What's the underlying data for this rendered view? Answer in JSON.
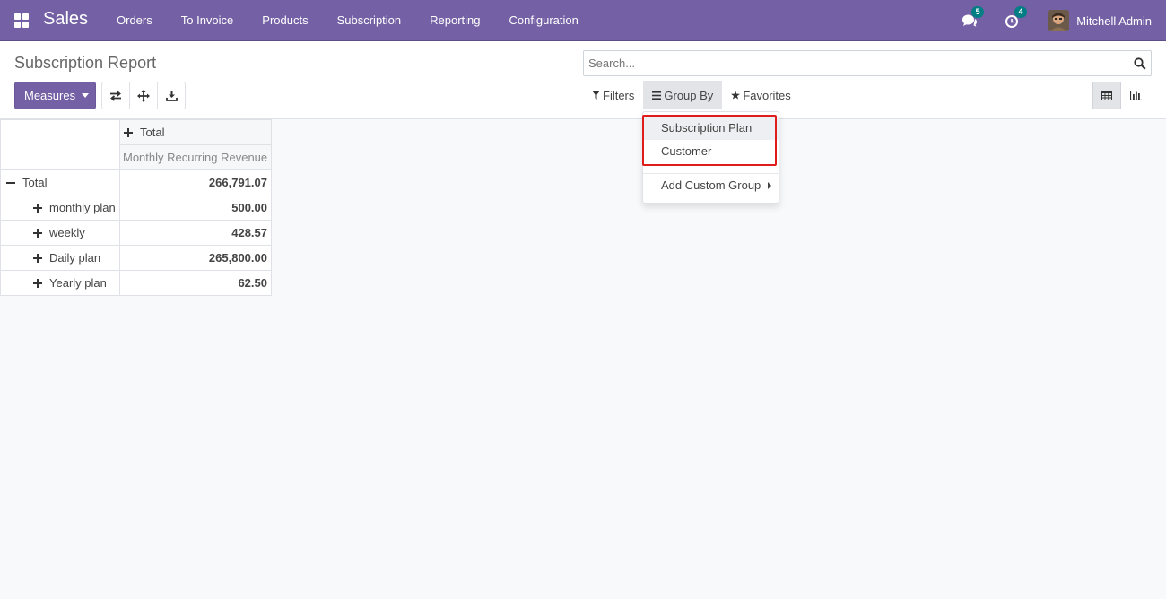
{
  "navbar": {
    "brand": "Sales",
    "menu": [
      "Orders",
      "To Invoice",
      "Products",
      "Subscription",
      "Reporting",
      "Configuration"
    ],
    "messages_badge": "5",
    "activities_badge": "4",
    "user_name": "Mitchell Admin"
  },
  "control_panel": {
    "title": "Subscription Report",
    "measures_label": "Measures",
    "search_placeholder": "Search...",
    "filters_label": "Filters",
    "group_by_label": "Group By",
    "favorites_label": "Favorites"
  },
  "group_by_menu": {
    "items": [
      "Subscription Plan",
      "Customer"
    ],
    "add_custom_group": "Add Custom Group"
  },
  "pivot": {
    "column_header": "Total",
    "measure": "Monthly Recurring Revenue",
    "total_row": {
      "label": "Total",
      "value": "266,791.07"
    },
    "rows": [
      {
        "label": "monthly plan",
        "value": "500.00"
      },
      {
        "label": "weekly",
        "value": "428.57"
      },
      {
        "label": "Daily plan",
        "value": "265,800.00"
      },
      {
        "label": "Yearly plan",
        "value": "62.50"
      }
    ]
  },
  "colors": {
    "navbar": "#7460a4",
    "primary_button": "#7460a4",
    "badge": "#017e84",
    "highlight_box": "#e01b1b"
  }
}
